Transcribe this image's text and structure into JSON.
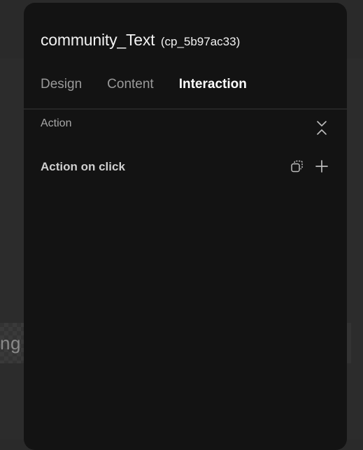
{
  "background": {
    "partial_text": "ng"
  },
  "panel": {
    "title": "community_Text",
    "component_id": "(cp_5b97ac33)",
    "tabs": [
      {
        "label": "Design",
        "active": false
      },
      {
        "label": "Content",
        "active": false
      },
      {
        "label": "Interaction",
        "active": true
      }
    ],
    "section": {
      "label": "Action",
      "toggle_icon": "collapse-icon"
    },
    "action": {
      "label": "Action on click",
      "copy_icon": "copy-icon",
      "add_icon": "plus-icon"
    }
  },
  "colors": {
    "panel_bg": "#131313",
    "page_bg": "#2a2a2a",
    "active_tab": "#ffffff",
    "inactive_tab": "#9a9a9a"
  }
}
